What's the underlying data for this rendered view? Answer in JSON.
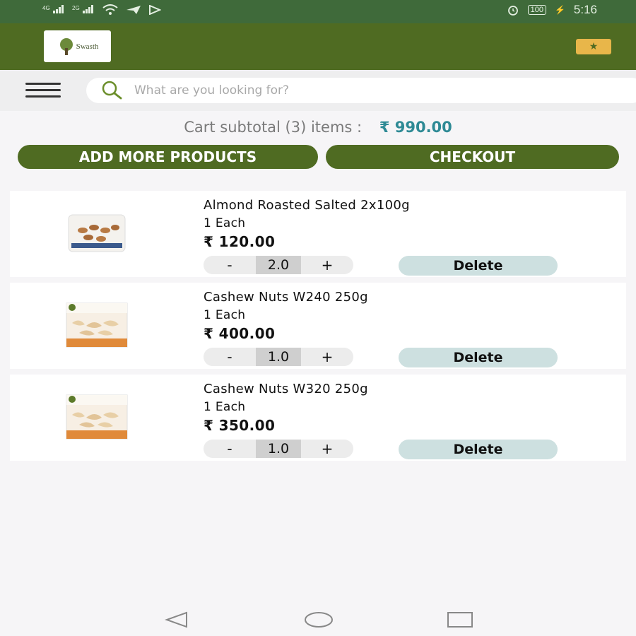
{
  "status_bar": {
    "signal_1": "4G",
    "signal_2": "2G",
    "battery": "100",
    "time": "5:16",
    "icons": [
      "signal-icon",
      "signal-icon",
      "wifi-icon",
      "telegram-icon",
      "play-store-icon",
      "alarm-icon",
      "battery-icon",
      "charging-icon"
    ]
  },
  "app_bar": {
    "logo_text": "Swasth",
    "right_icon": "star-ticket-icon"
  },
  "search": {
    "placeholder": "What are you looking for?"
  },
  "cart": {
    "subtotal_label": "Cart subtotal (3) items :",
    "subtotal_amount": "₹ 990.00",
    "add_more_label": "ADD MORE PRODUCTS",
    "checkout_label": "CHECKOUT",
    "items": [
      {
        "name": "Almond Roasted Salted 2x100g",
        "unit": "1 Each",
        "price": "₹ 120.00",
        "minus": "-",
        "quantity": "2.0",
        "plus": "+",
        "delete_label": "Delete"
      },
      {
        "name": "Cashew Nuts W240 250g",
        "unit": "1 Each",
        "price": "₹ 400.00",
        "minus": "-",
        "quantity": "1.0",
        "plus": "+",
        "delete_label": "Delete"
      },
      {
        "name": "Cashew Nuts W320 250g",
        "unit": "1 Each",
        "price": "₹ 350.00",
        "minus": "-",
        "quantity": "1.0",
        "plus": "+",
        "delete_label": "Delete"
      }
    ]
  },
  "colors": {
    "status_bar": "#3f6a3a",
    "app_bar": "#4f6b22",
    "accent_price": "#2e8a95",
    "delete_bg": "#cde0e0"
  },
  "nav": {
    "icons": [
      "back-icon",
      "home-icon",
      "recents-icon"
    ]
  }
}
